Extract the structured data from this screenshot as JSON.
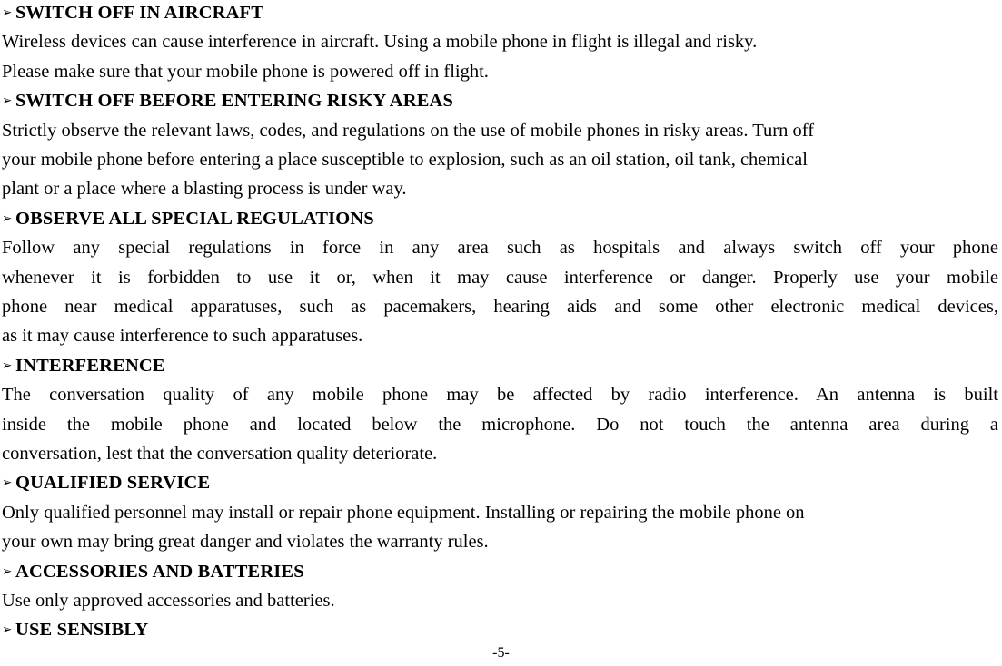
{
  "document": {
    "page_number_label": "-5-",
    "bullet_glyph": "➢"
  },
  "sections": [
    {
      "heading": "SWITCH OFF IN AIRCRAFT",
      "lines": [
        "Wireless devices can cause interference in aircraft. Using a mobile phone in flight is illegal and risky.",
        "Please make sure that your mobile phone is powered off in flight."
      ],
      "justified": false
    },
    {
      "heading": "SWITCH OFF BEFORE ENTERING RISKY AREAS",
      "lines": [
        "Strictly observe the relevant laws, codes, and regulations on the use of mobile phones in risky areas. Turn off",
        "your mobile phone before entering a place susceptible to explosion, such as an oil station, oil tank, chemical",
        "plant or a place where a blasting process is under way."
      ],
      "justified": false
    },
    {
      "heading": "OBSERVE ALL SPECIAL REGULATIONS",
      "lines": [
        "Follow any special regulations in force in any area such as hospitals and always switch off your phone",
        "whenever it is forbidden to use it or, when it may cause interference or danger. Properly use your mobile",
        "phone near medical apparatuses, such as pacemakers, hearing aids and some other electronic medical devices,",
        "as it may cause interference to such apparatuses."
      ],
      "justified": true
    },
    {
      "heading": "INTERFERENCE",
      "lines": [
        "The conversation quality of any mobile phone may be affected by radio interference. An antenna is built",
        "inside the mobile phone and located below the microphone. Do not touch the antenna area during a",
        "conversation, lest that the conversation quality deteriorate."
      ],
      "justified": true
    },
    {
      "heading": "QUALIFIED SERVICE",
      "lines": [
        "Only qualified personnel may install or repair phone equipment. Installing or repairing the mobile phone on",
        "your own may bring great danger and violates the warranty rules."
      ],
      "justified": false
    },
    {
      "heading": "ACCESSORIES AND BATTERIES",
      "lines": [
        "Use only approved accessories and batteries."
      ],
      "justified": false
    },
    {
      "heading": "USE SENSIBLY",
      "lines": [],
      "justified": false
    }
  ]
}
